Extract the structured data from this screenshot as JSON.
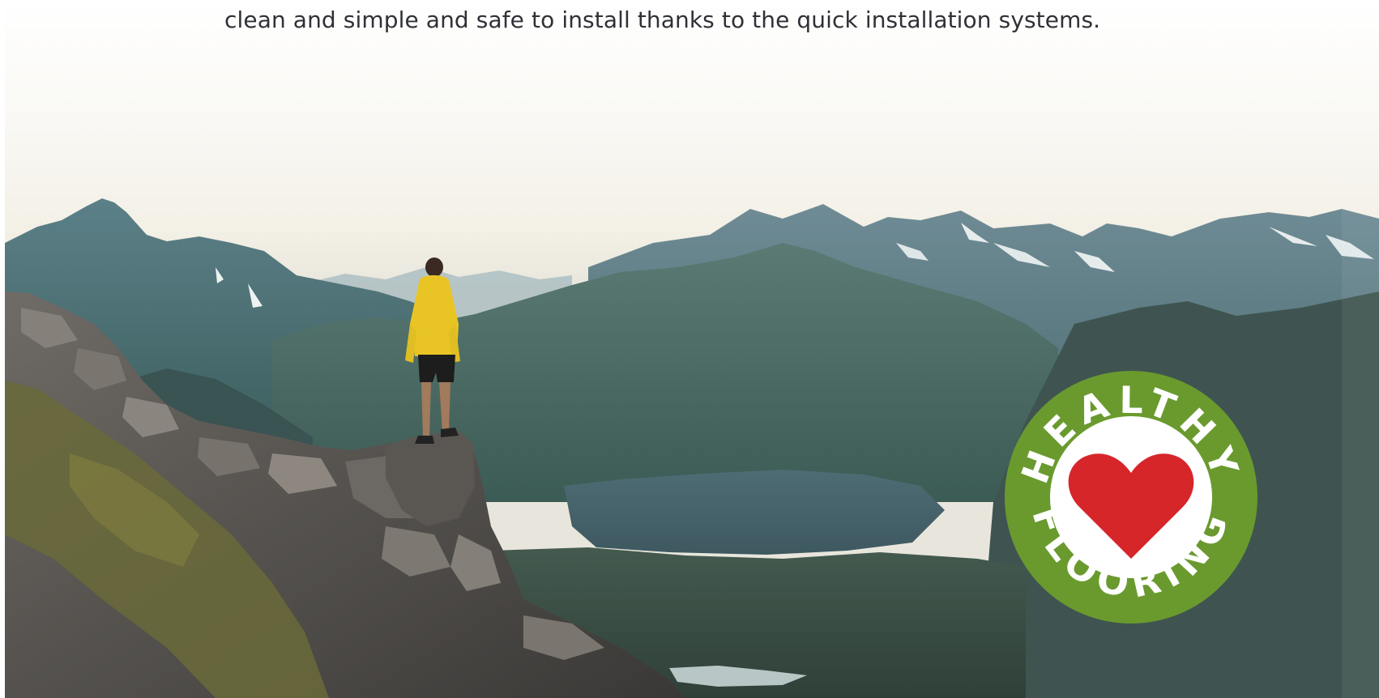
{
  "intro": {
    "text": "clean and simple and safe to install thanks to the quick installation systems."
  },
  "hero_image": {
    "subject": "hiker-on-mountain-ledge",
    "icon": "mountain-landscape-photo"
  },
  "badge": {
    "top_word": "HEALTHY",
    "bottom_word": "FLOORING",
    "icon": "heart-icon",
    "colors": {
      "ring": "#6a9a2e",
      "inner": "#ffffff",
      "heart": "#d6262a",
      "text": "#ffffff"
    }
  }
}
